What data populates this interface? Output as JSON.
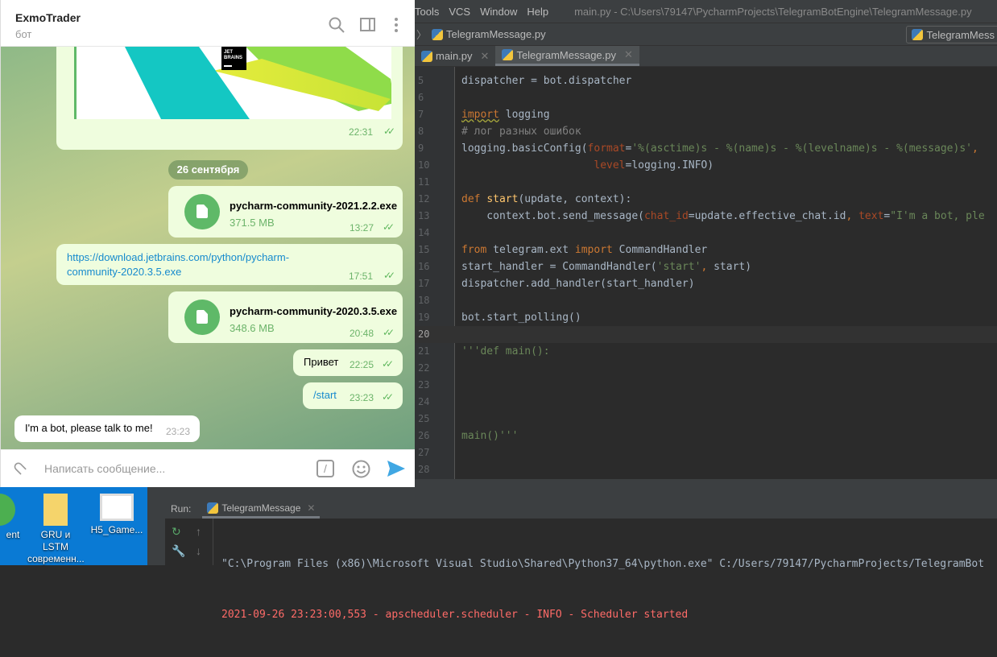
{
  "telegram": {
    "chat_name": "ExmoTrader",
    "chat_subtitle": "бот",
    "messages": {
      "preview_time": "22:31",
      "preview_logo": "JET BRAINS",
      "date_separator": "26 сентября",
      "file1": {
        "name": "pycharm-community-2021.2.2.exe",
        "size": "371.5 MB",
        "time": "13:27"
      },
      "link": {
        "line1": "https://download.jetbrains.com/python/pycharm-",
        "line2": "community-2020.3.5.exe",
        "time": "17:51"
      },
      "file2": {
        "name": "pycharm-community-2020.3.5.exe",
        "size": "348.6 MB",
        "time": "20:48"
      },
      "privet": {
        "text": "Привет",
        "time": "22:25"
      },
      "start": {
        "text": "/start",
        "time": "23:23"
      },
      "reply": {
        "text": "I'm a bot, please talk to me!",
        "time": "23:23"
      }
    },
    "input_placeholder": "Написать сообщение...",
    "commands_icon_label": "/"
  },
  "ide": {
    "menu": [
      "Tools",
      "VCS",
      "Window",
      "Help"
    ],
    "window_title": "main.py - C:\\Users\\79147\\PycharmProjects\\TelegramBotEngine\\TelegramMessage.py",
    "breadcrumb": "TelegramMessage.py",
    "run_config": "TelegramMess",
    "tabs": [
      {
        "label": "main.py",
        "active": false
      },
      {
        "label": "TelegramMessage.py",
        "active": true
      }
    ],
    "current_line": 20,
    "lines": [
      {
        "n": 5,
        "t": [
          [
            "dispatcher = bot.dispatcher",
            ""
          ]
        ]
      },
      {
        "n": 6,
        "t": []
      },
      {
        "n": 7,
        "t": [
          [
            "import",
            "kw wavy"
          ],
          [
            " logging",
            ""
          ]
        ]
      },
      {
        "n": 8,
        "t": [
          [
            "# лог разных ошибок",
            "cm"
          ]
        ]
      },
      {
        "n": 9,
        "t": [
          [
            "logging.basicConfig(",
            ""
          ],
          [
            "format",
            "prm"
          ],
          [
            "=",
            ""
          ],
          [
            "'%(asctime)s - %(name)s - %(levelname)s - %(message)s'",
            "str"
          ],
          [
            ",",
            "kw"
          ]
        ]
      },
      {
        "n": 10,
        "t": [
          [
            "                     ",
            ""
          ],
          [
            "level",
            "prm"
          ],
          [
            "=logging.INFO)",
            ""
          ]
        ]
      },
      {
        "n": 11,
        "t": []
      },
      {
        "n": 12,
        "t": [
          [
            "def ",
            "kw"
          ],
          [
            "start",
            "fn"
          ],
          [
            "(update, context):",
            ""
          ]
        ]
      },
      {
        "n": 13,
        "t": [
          [
            "    context.bot.send_message(",
            ""
          ],
          [
            "chat_id",
            "prm"
          ],
          [
            "=update.effective_chat.id",
            ""
          ],
          [
            ", ",
            "kw"
          ],
          [
            "text",
            "prm"
          ],
          [
            "=",
            ""
          ],
          [
            "\"I'm a bot, ple",
            "str"
          ]
        ]
      },
      {
        "n": 14,
        "t": []
      },
      {
        "n": 15,
        "t": [
          [
            "from",
            "kw"
          ],
          [
            " telegram.ext ",
            ""
          ],
          [
            "import",
            "kw"
          ],
          [
            " CommandHandler",
            ""
          ]
        ]
      },
      {
        "n": 16,
        "t": [
          [
            "start_handler = CommandHandler(",
            ""
          ],
          [
            "'start'",
            "str"
          ],
          [
            ", ",
            "kw"
          ],
          [
            "start)",
            ""
          ]
        ]
      },
      {
        "n": 17,
        "t": [
          [
            "dispatcher.add_handler(start_handler)",
            ""
          ]
        ]
      },
      {
        "n": 18,
        "t": []
      },
      {
        "n": 19,
        "t": [
          [
            "bot.start_polling()",
            ""
          ]
        ]
      },
      {
        "n": 20,
        "t": []
      },
      {
        "n": 21,
        "t": [
          [
            "'''def main():",
            "str"
          ]
        ]
      },
      {
        "n": 22,
        "t": []
      },
      {
        "n": 23,
        "t": []
      },
      {
        "n": 24,
        "t": []
      },
      {
        "n": 25,
        "t": []
      },
      {
        "n": 26,
        "t": [
          [
            "main()'''",
            "str"
          ]
        ]
      },
      {
        "n": 27,
        "t": []
      },
      {
        "n": 28,
        "t": []
      }
    ],
    "run": {
      "label": "Run:",
      "tab": "TelegramMessage",
      "console": [
        "\"C:\\Program Files (x86)\\Microsoft Visual Studio\\Shared\\Python37_64\\python.exe\" C:/Users/79147/PycharmProjects/TelegramBot",
        "2021-09-26 23:23:00,553 - apscheduler.scheduler - INFO - Scheduler started"
      ]
    }
  },
  "desktop": {
    "icons": [
      "ent",
      "GRU и LSTM современн...",
      "H5_Game..."
    ]
  }
}
